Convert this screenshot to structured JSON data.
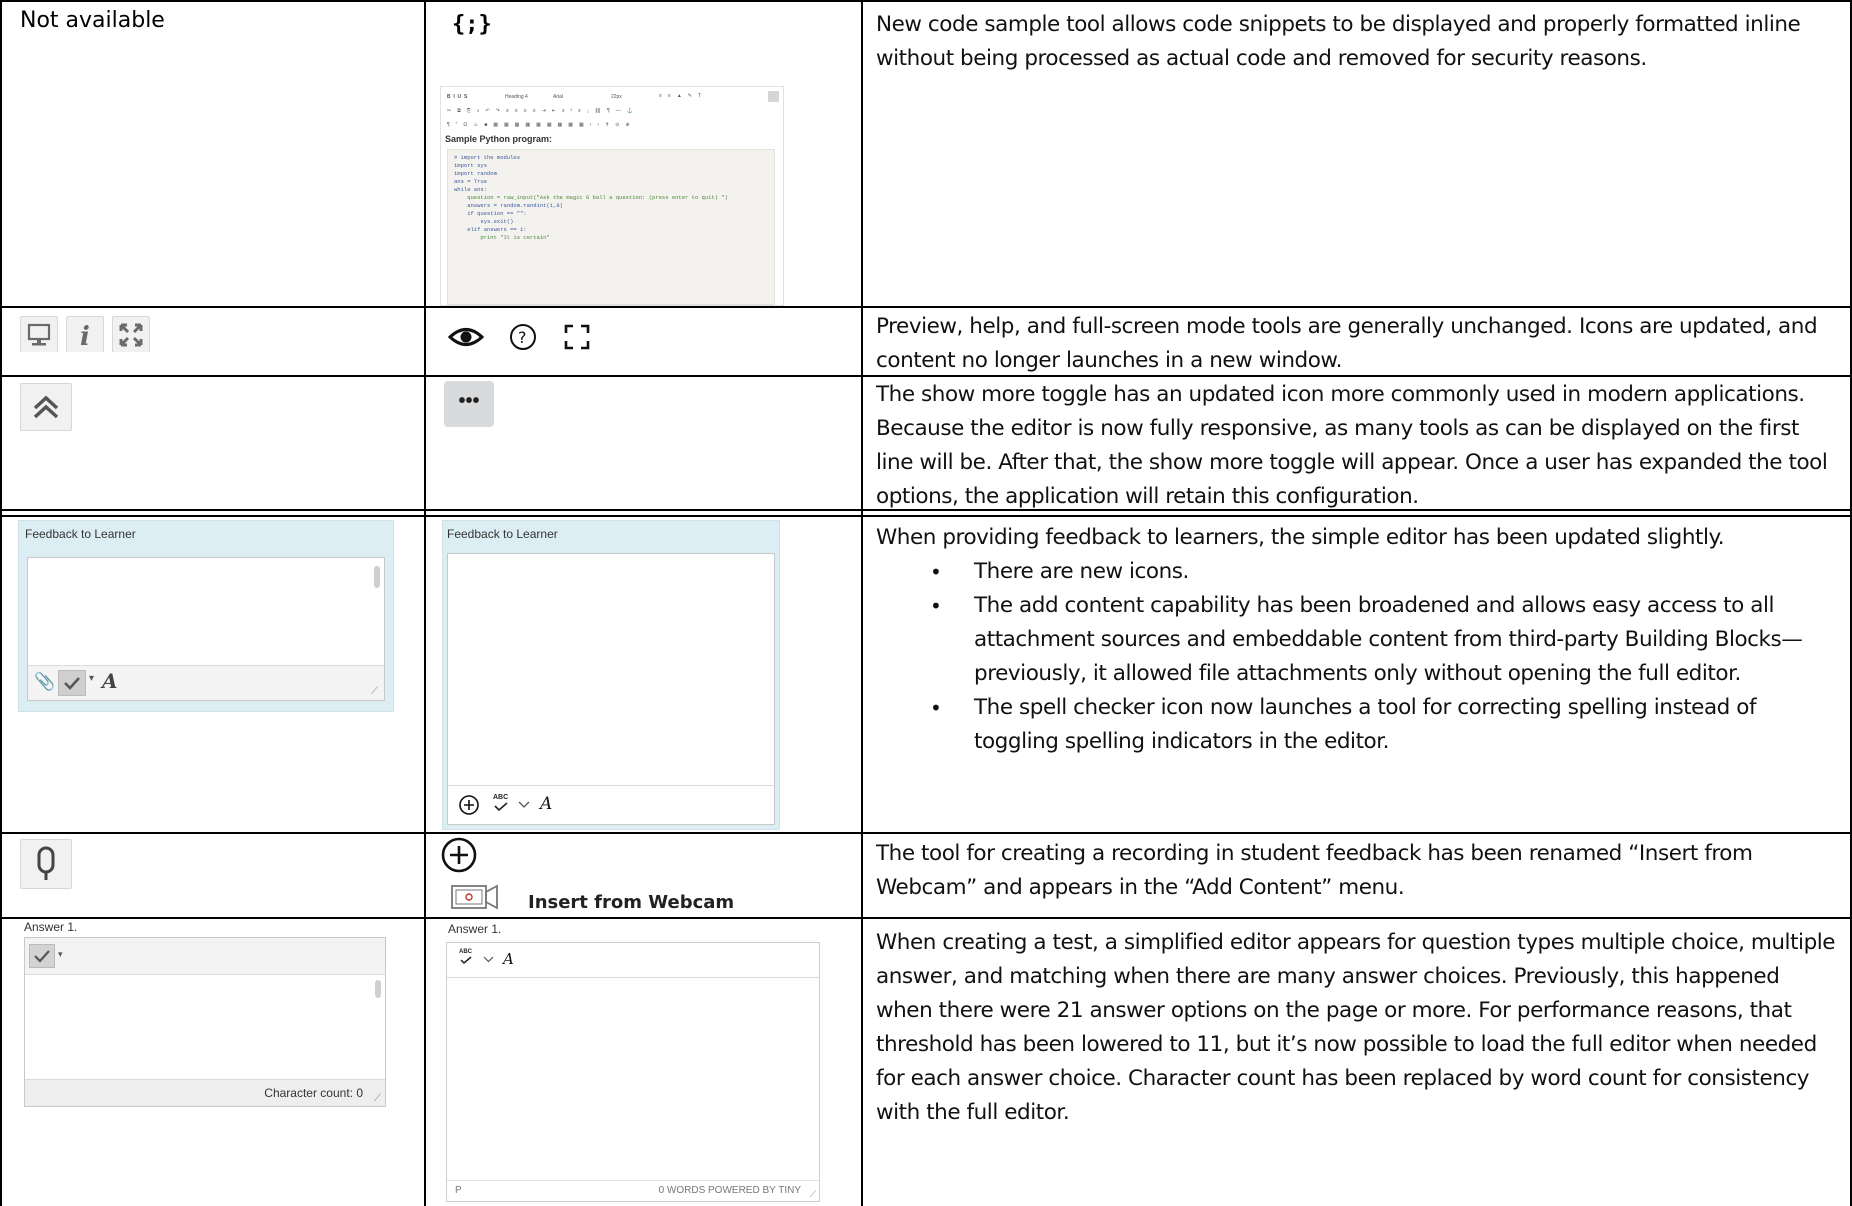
{
  "rows": [
    {
      "original": {
        "not_available": "Not available"
      },
      "ultra": {
        "code_icon": "{;}",
        "toolbar": {
          "heading": "Heading 4",
          "font": "Arial",
          "size": "22px"
        },
        "sample_title": "Sample Python program:",
        "code_lines": [
          "# import the modules",
          "import sys",
          "import random",
          "",
          "ans = True",
          "",
          "while ans:",
          "    question = raw_input(\"Ask the magic 8 ball a question: (press enter to quit) \")",
          "",
          "    answers = random.randint(1,8)",
          "",
          "    if question == \"\":",
          "        sys.exit()",
          "",
          "    elif answers == 1:",
          "        print \"It is certain\""
        ]
      },
      "description": "New code sample tool allows code snippets to be displayed and properly formatted inline without being processed as actual code and removed for security reasons."
    },
    {
      "original": {
        "icons": [
          "monitor-icon",
          "info-icon",
          "fullscreen-icon"
        ]
      },
      "ultra": {
        "icons": [
          "eye-icon",
          "help-icon",
          "expand-icon"
        ]
      },
      "description": "Preview, help, and full-screen mode tools are generally unchanged. Icons are updated, and content no longer launches in a new window."
    },
    {
      "original": {
        "icon": "double-chevron-up-icon"
      },
      "ultra": {
        "icon_text": "•••"
      },
      "description": "The show more toggle has an updated icon more commonly used in modern applications. Because the editor is now fully responsive, as many tools as can be displayed on the first line will be. After that, the show more toggle will appear. Once a user has expanded the tool options, the application will retain this configuration."
    },
    {
      "original": {
        "panel_label": "Feedback to Learner"
      },
      "ultra": {
        "panel_label": "Feedback to Learner",
        "spell_label": "ABC"
      },
      "description": "When providing feedback to learners, the simple editor has been updated slightly.",
      "bullets": [
        "There are new icons.",
        "The add content capability has been broadened and allows easy access to all attachment sources and embeddable content from third-party Building Blocks—previously, it allowed file attachments only without opening the full editor.",
        "The spell checker icon now launches a tool for correcting spelling instead of toggling spelling indicators in the editor."
      ]
    },
    {
      "original": {
        "icon": "microphone-icon"
      },
      "ultra": {
        "menu_label": "Insert from Webcam"
      },
      "description": "The tool for creating a recording in student feedback has been renamed “Insert from Webcam” and appears in the “Add Content” menu."
    },
    {
      "original": {
        "answer_label": "Answer 1.",
        "char_count": "Character count: 0"
      },
      "ultra": {
        "answer_label": "Answer 1.",
        "status_left": "P",
        "status_right": "0 WORDS  POWERED BY TINY"
      },
      "description": "When creating a test, a simplified editor appears for question types multiple choice, multiple answer, and matching when there are many answer choices. Previously, this happened when there were 21 answer options on the page or more. For performance reasons, that threshold has been lowered to 11, but it’s now possible to load the full editor when needed for each answer choice. Character count has been replaced by word count for consistency with the full editor."
    }
  ]
}
